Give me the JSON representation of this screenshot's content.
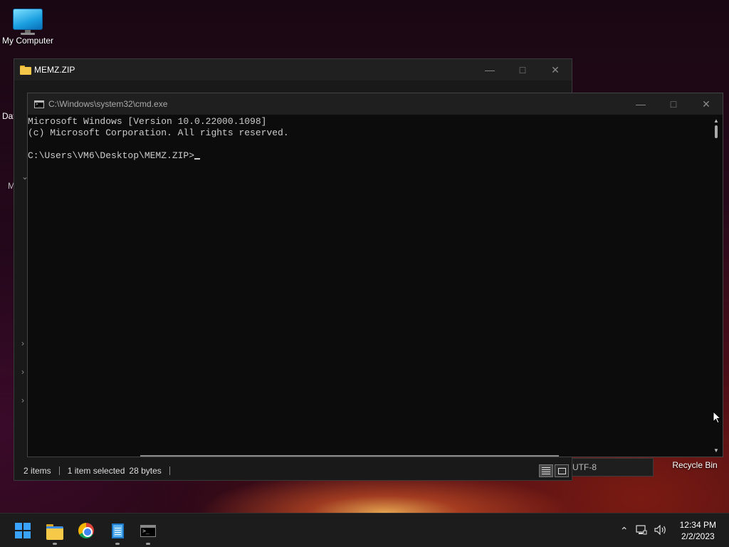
{
  "desktop": {
    "icons": [
      {
        "label": "My Computer"
      },
      {
        "label": "Recycle Bin"
      }
    ],
    "partial_labels": [
      "Dat",
      "M"
    ]
  },
  "explorer": {
    "title": "MEMZ.ZIP",
    "status": {
      "items": "2 items",
      "selected": "1 item selected",
      "size": "28 bytes"
    }
  },
  "notepad": {
    "encoding": "UTF-8"
  },
  "cmd": {
    "title": "C:\\Windows\\system32\\cmd.exe",
    "lines": [
      "Microsoft Windows [Version 10.0.22000.1098]",
      "(c) Microsoft Corporation. All rights reserved.",
      "",
      "C:\\Users\\VM6\\Desktop\\MEMZ.ZIP>"
    ]
  },
  "taskbar": {
    "apps": [
      "start-icon",
      "file-explorer-icon",
      "chrome-icon",
      "notepad-icon",
      "cmd-icon"
    ],
    "clock": {
      "time": "12:34 PM",
      "date": "2/2/2023"
    }
  },
  "colors": {
    "console_bg": "#0c0c0c",
    "console_text": "#cccccc",
    "accent": "#3aa3ff"
  }
}
